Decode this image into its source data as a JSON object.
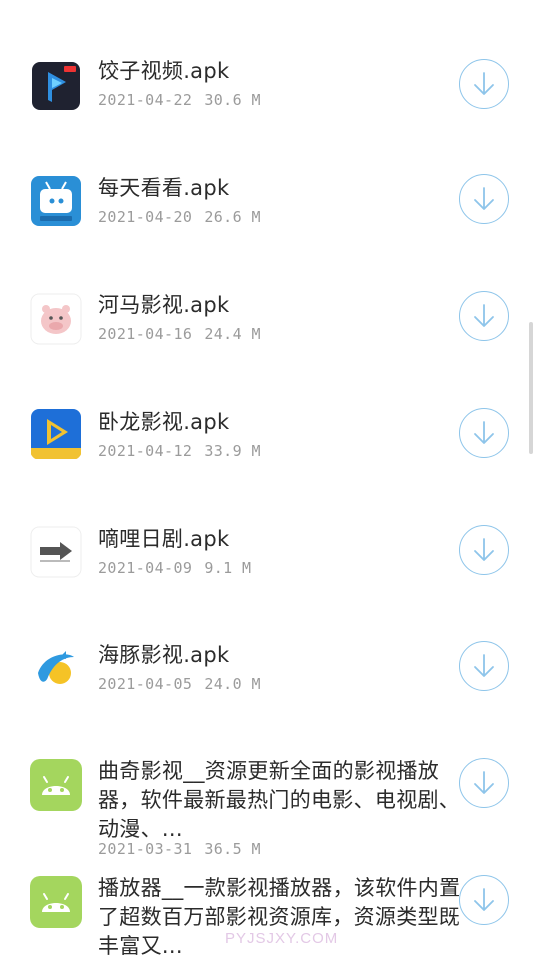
{
  "files": [
    {
      "name": "饺子视频.apk",
      "date": "2021-04-22",
      "size": "30.6 M",
      "icon": "jiaozi-video-app-icon"
    },
    {
      "name": "每天看看.apk",
      "date": "2021-04-20",
      "size": "26.6 M",
      "icon": "tv-app-icon"
    },
    {
      "name": "河马影视.apk",
      "date": "2021-04-16",
      "size": "24.4 M",
      "icon": "hippo-app-icon"
    },
    {
      "name": "卧龙影视.apk",
      "date": "2021-04-12",
      "size": "33.9 M",
      "icon": "play-app-icon"
    },
    {
      "name": "嘀哩日剧.apk",
      "date": "2021-04-09",
      "size": "9.1 M",
      "icon": "arrow-app-icon"
    },
    {
      "name": "海豚影视.apk",
      "date": "2021-04-05",
      "size": "24.0 M",
      "icon": "dolphin-app-icon"
    },
    {
      "name": "曲奇影视__资源更新全面的影视播放器，软件最新最热门的电影、电视剧、动漫、...",
      "date": "2021-03-31",
      "size": "36.5 M",
      "icon": "android-app-icon"
    },
    {
      "name": "播放器__一款影视播放器，该软件内置了超数百万部影视资源库，资源类型既丰富又...",
      "date": "",
      "size": "",
      "icon": "android-app-icon"
    }
  ],
  "download_icon": "download-arrow-icon",
  "watermark": "PYJSJXY.COM",
  "colors": {
    "accent": "#8ec5ea",
    "android": "#a4d65e",
    "meta": "#9b9b9b"
  }
}
